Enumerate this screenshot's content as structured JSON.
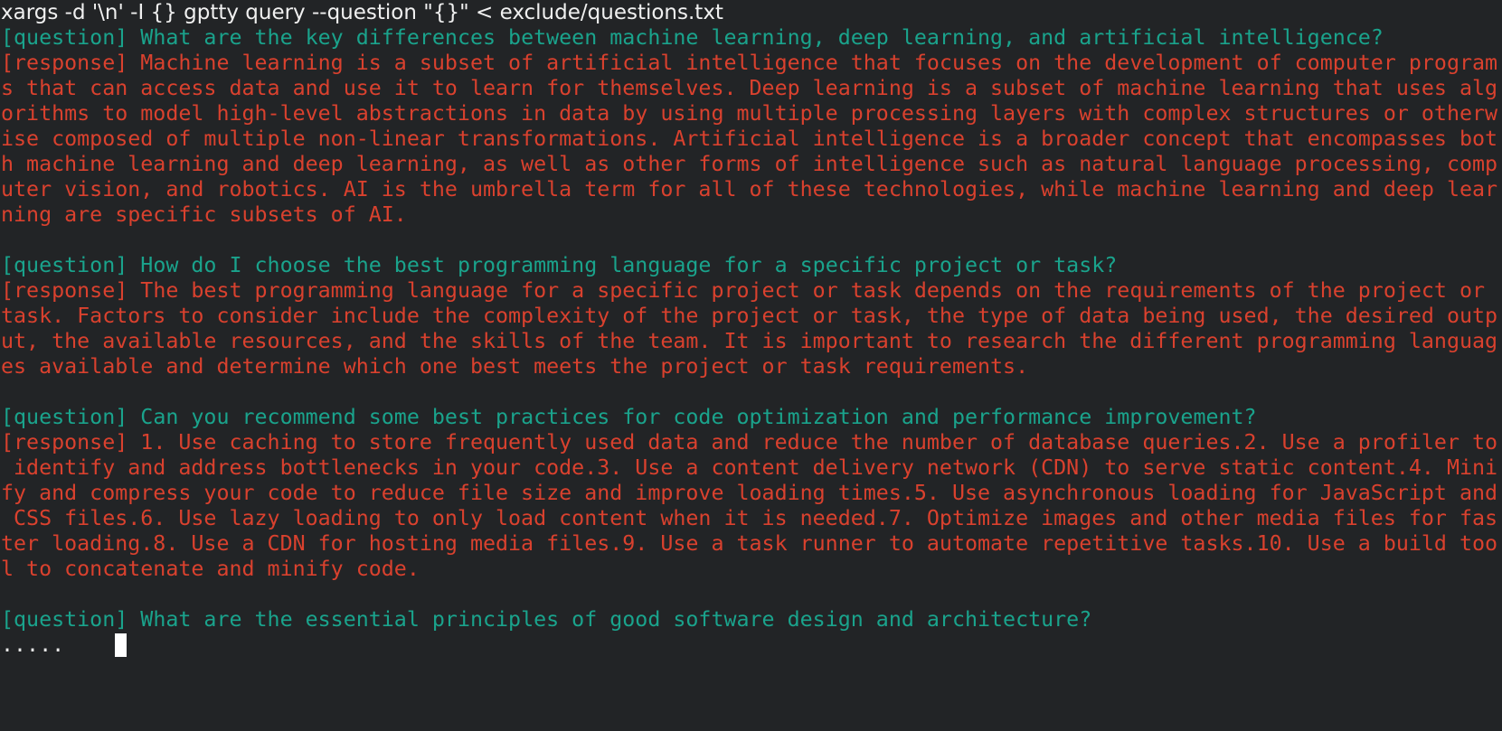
{
  "command": "xargs -d '\\n' -I {} gptty query --question \"{}\" < exclude/questions.txt",
  "tags": {
    "question": "[question]",
    "response": "[response]"
  },
  "qa": [
    {
      "question": " What are the key differences between machine learning, deep learning, and artificial intelligence?",
      "response_lines": [
        " Machine learning is a subset of artificial intelligence that focuses on the development of computer program",
        "s that can access data and use it to learn for themselves. Deep learning is a subset of machine learning that uses alg",
        "orithms to model high-level abstractions in data by using multiple processing layers with complex structures or otherw",
        "ise composed of multiple non-linear transformations. Artificial intelligence is a broader concept that encompasses bot",
        "h machine learning and deep learning, as well as other forms of intelligence such as natural language processing, comp",
        "uter vision, and robotics. AI is the umbrella term for all of these technologies, while machine learning and deep lear",
        "ning are specific subsets of AI."
      ]
    },
    {
      "question": " How do I choose the best programming language for a specific project or task?",
      "response_lines": [
        " The best programming language for a specific project or task depends on the requirements of the project or",
        "task. Factors to consider include the complexity of the project or task, the type of data being used, the desired outp",
        "ut, the available resources, and the skills of the team. It is important to research the different programming languag",
        "es available and determine which one best meets the project or task requirements."
      ]
    },
    {
      "question": " Can you recommend some best practices for code optimization and performance improvement?",
      "response_lines": [
        " 1. Use caching to store frequently used data and reduce the number of database queries.2. Use a profiler to",
        " identify and address bottlenecks in your code.3. Use a content delivery network (CDN) to serve static content.4. Mini",
        "fy and compress your code to reduce file size and improve loading times.5. Use asynchronous loading for JavaScript and",
        " CSS files.6. Use lazy loading to only load content when it is needed.7. Optimize images and other media files for fas",
        "ter loading.8. Use a CDN for hosting media files.9. Use a task runner to automate repetitive tasks.10. Use a build too",
        "l to concatenate and minify code."
      ]
    }
  ],
  "pending_question": " What are the essential principles of good software design and architecture?",
  "progress_dots": ".....    ",
  "colors": {
    "background": "#222426",
    "question": "#1aa38c",
    "response": "#d9412e",
    "command": "#f0f0f0"
  }
}
